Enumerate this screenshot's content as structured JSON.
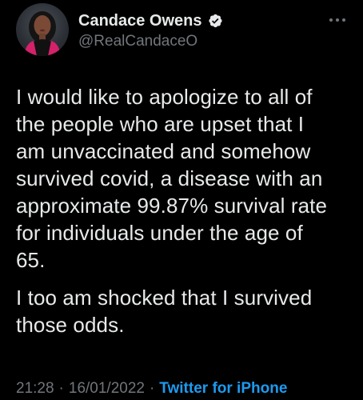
{
  "tweet": {
    "author": {
      "display_name": "Candace Owens",
      "handle": "@RealCandaceO",
      "verified": true,
      "avatar_icon": "profile-photo"
    },
    "more_icon": "more-horizontal-icon",
    "paragraphs": [
      "I would like to apologize to all of\nthe people who are upset that I\nam unvaccinated and somehow\nsurvived covid, a disease with an\napproximate 99.87% survival rate\nfor individuals under the age of\n65.",
      "I too am shocked that I survived\nthose odds."
    ],
    "time": "21:28",
    "date": "16/01/2022",
    "separator": "·",
    "source": "Twitter for iPhone"
  },
  "colors": {
    "background": "#000000",
    "text_primary": "#e7e9ea",
    "text_secondary": "#71767b",
    "accent": "#1d9bf0"
  }
}
